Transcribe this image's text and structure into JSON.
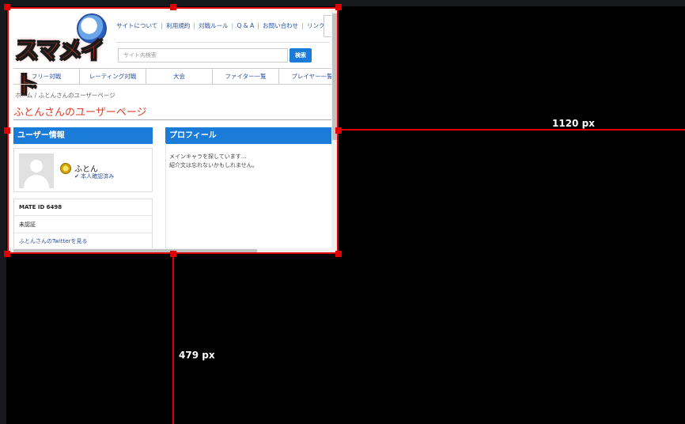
{
  "site": {
    "logo_text_a": "スマ",
    "logo_text_b": "メイト",
    "topnav": [
      "サイトについて",
      "利用規約",
      "対戦ルール",
      "Q & A",
      "お問い合わせ",
      "リンク集"
    ],
    "search_placeholder": "サイト内検索",
    "search_button": "検索",
    "mainnav": [
      "フリー対戦",
      "レーティング対戦",
      "大会",
      "ファイター一覧",
      "プレイヤー一覧"
    ],
    "breadcrumb": "ホーム / ふとんさんのユーザーページ",
    "page_title": "ふとんさんのユーザーページ"
  },
  "user_panel": {
    "header": "ユーザー情報",
    "username": "ふとん",
    "verified": "本人確認済み",
    "mate_id": "MATE ID 6498",
    "status": "未認証",
    "twitter_link": "ふとんさんのTwitterを見る"
  },
  "profile_panel": {
    "header": "プロフィール",
    "lines": [
      "メインキャラを探しています…",
      "紹介文は忘れないかもしれません。"
    ]
  },
  "overlay": {
    "width_label": "1120 px",
    "height_label": "479 px",
    "accent": "#e00000"
  },
  "colors": {
    "brand_blue": "#1a7bd9",
    "title_red": "#e03d2b",
    "link_blue": "#2c4fa3"
  }
}
